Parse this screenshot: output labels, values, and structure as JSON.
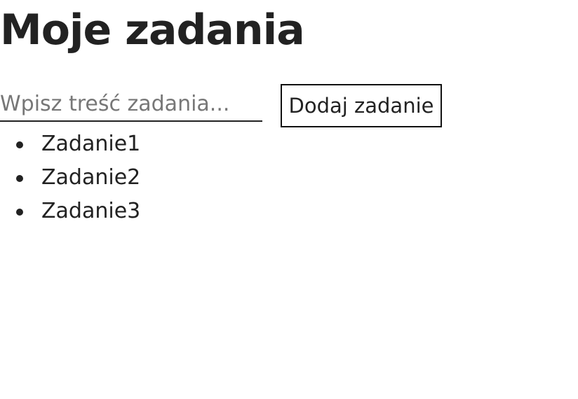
{
  "page": {
    "title": "Moje zadania"
  },
  "form": {
    "input_placeholder": "Wpisz treść zadania...",
    "input_value": "",
    "add_button_label": "Dodaj zadanie"
  },
  "tasks": [
    {
      "label": "Zadanie1"
    },
    {
      "label": "Zadanie2"
    },
    {
      "label": "Zadanie3"
    }
  ]
}
